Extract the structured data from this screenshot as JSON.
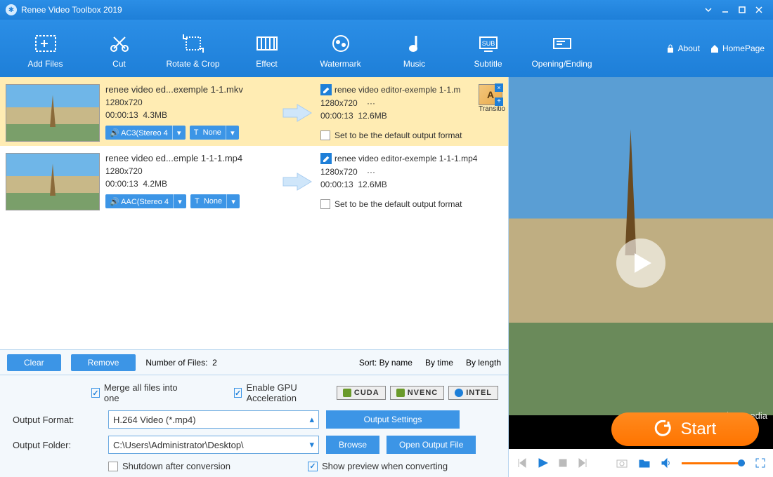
{
  "title": "Renee Video Toolbox 2019",
  "toolbar": {
    "items": [
      "Add Files",
      "Cut",
      "Rotate & Crop",
      "Effect",
      "Watermark",
      "Music",
      "Subtitle",
      "Opening/Ending"
    ],
    "about": "About",
    "homepage": "HomePage"
  },
  "files": [
    {
      "name": "renee video ed...exemple 1-1.mkv",
      "res": "1280x720",
      "dur": "00:00:13",
      "size": "4.3MB",
      "outname": "renee video editor-exemple 1-1.m",
      "outres": "1280x720",
      "outmore": "···",
      "outdur": "00:00:13",
      "outsize": "12.6MB",
      "audio": "AC3(Stereo 4",
      "sub": "None",
      "transition": "Transitio",
      "selected": true
    },
    {
      "name": "renee video ed...emple 1-1-1.mp4",
      "res": "1280x720",
      "dur": "00:00:13",
      "size": "4.2MB",
      "outname": "renee video editor-exemple 1-1-1.mp4",
      "outres": "1280x720",
      "outmore": "···",
      "outdur": "00:00:13",
      "outsize": "12.6MB",
      "audio": "AAC(Stereo 4",
      "sub": "None",
      "selected": false
    }
  ],
  "default_check_label": "Set to be the default output format",
  "listctl": {
    "clear": "Clear",
    "remove": "Remove",
    "countlabel": "Number of Files:",
    "count": "2",
    "sortlabel": "Sort:",
    "sorts": [
      "By name",
      "By time",
      "By length"
    ]
  },
  "bottom": {
    "merge": "Merge all files into one",
    "gpu": "Enable GPU Acceleration",
    "gpu_badges": [
      "CUDA",
      "NVENC",
      "INTEL"
    ],
    "format_label": "Output Format:",
    "format_value": "H.264 Video (*.mp4)",
    "folder_label": "Output Folder:",
    "folder_value": "C:\\Users\\Administrator\\Desktop\\",
    "output_settings": "Output Settings",
    "browse": "Browse",
    "open_output": "Open Output File",
    "shutdown": "Shutdown after conversion",
    "showprev": "Show preview when converting"
  },
  "start": "Start",
  "preview": {
    "watermark": "Expedia"
  }
}
